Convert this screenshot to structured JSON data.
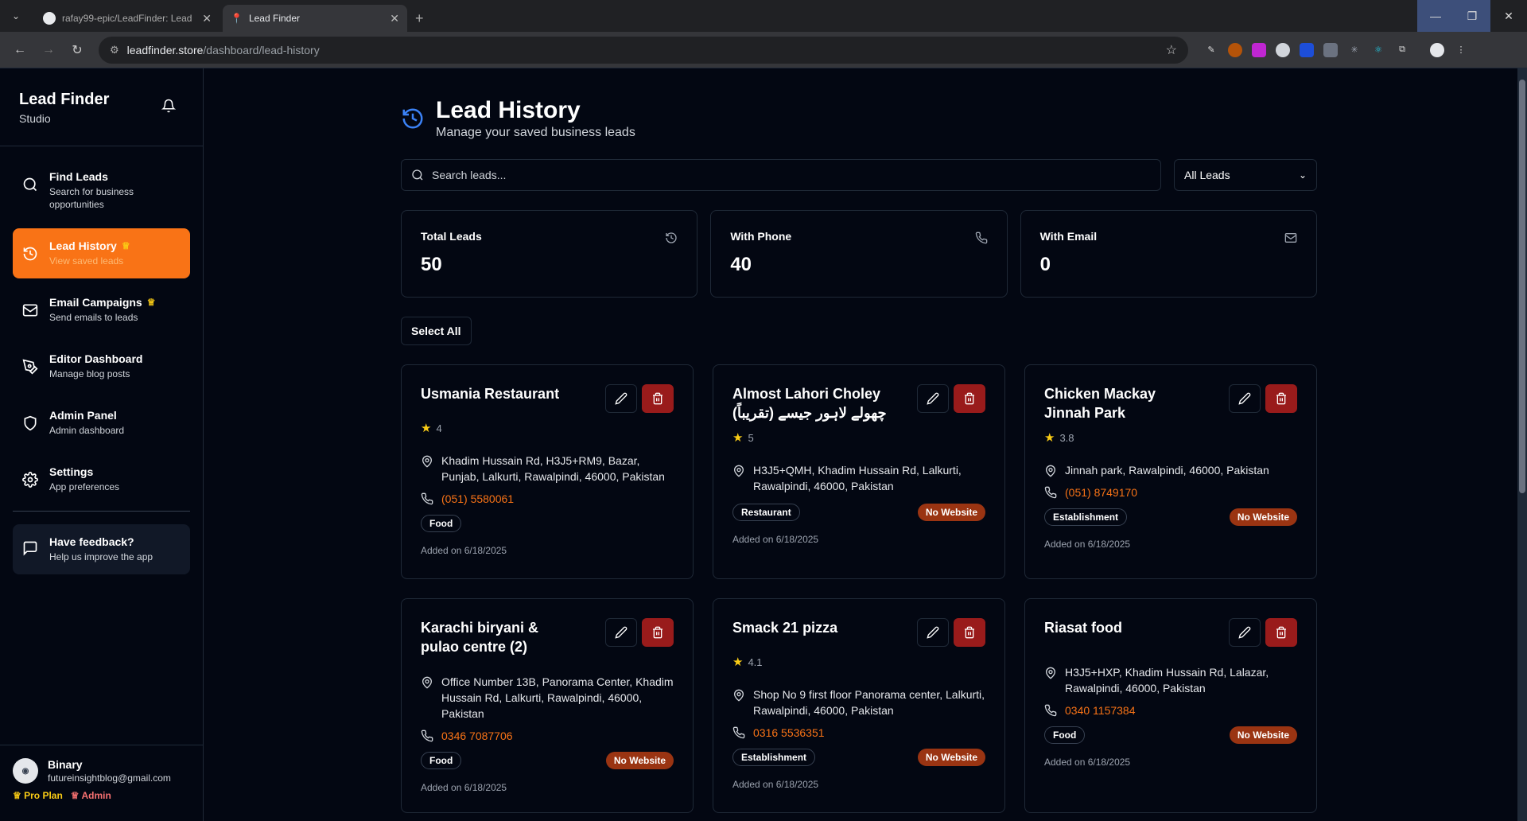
{
  "browser": {
    "tabs": [
      {
        "title": "rafay99-epic/LeadFinder: Lead",
        "active": false
      },
      {
        "title": "Lead Finder",
        "active": true
      }
    ],
    "url_host": "leadfinder.store",
    "url_path": "/dashboard/lead-history"
  },
  "sidebar": {
    "brand_title": "Lead Finder",
    "brand_sub": "Studio",
    "items": [
      {
        "label": "Find Leads",
        "desc": "Search for business opportunities",
        "icon": "search-icon",
        "active": false,
        "crown": false
      },
      {
        "label": "Lead History",
        "desc": "View saved leads",
        "icon": "history-icon",
        "active": true,
        "crown": true
      },
      {
        "label": "Email Campaigns",
        "desc": "Send emails to leads",
        "icon": "mail-icon",
        "active": false,
        "crown": true
      },
      {
        "label": "Editor Dashboard",
        "desc": "Manage blog posts",
        "icon": "pen-icon",
        "active": false,
        "crown": false
      },
      {
        "label": "Admin Panel",
        "desc": "Admin dashboard",
        "icon": "shield-icon",
        "active": false,
        "crown": false
      },
      {
        "label": "Settings",
        "desc": "App preferences",
        "icon": "gear-icon",
        "active": false,
        "crown": false
      }
    ],
    "feedback": {
      "label": "Have feedback?",
      "desc": "Help us improve the app"
    },
    "user": {
      "name": "Binary",
      "email": "futureinsightblog@gmail.com",
      "plan": "Pro Plan",
      "role": "Admin"
    }
  },
  "main": {
    "title": "Lead History",
    "subtitle": "Manage your saved business leads",
    "search_placeholder": "Search leads...",
    "filter_value": "All Leads",
    "stats": [
      {
        "label": "Total Leads",
        "value": "50",
        "icon": "history-icon"
      },
      {
        "label": "With Phone",
        "value": "40",
        "icon": "phone-icon"
      },
      {
        "label": "With Email",
        "value": "0",
        "icon": "mail-icon"
      }
    ],
    "select_all": "Select All",
    "leads": [
      {
        "name": "Usmania Restaurant",
        "rating": "4",
        "address": "Khadim Hussain Rd, H3J5+RM9, Bazar, Punjab, Lalkurti, Rawalpindi, 46000, Pakistan",
        "phone": "(051) 5580061",
        "tag": "Food",
        "no_website": "",
        "added": "Added on 6/18/2025"
      },
      {
        "name": "Almost Lahori Choley چھولے لاہور جیسے (تقریباً)",
        "rating": "5",
        "address": "H3J5+QMH, Khadim Hussain Rd, Lalkurti, Rawalpindi, 46000, Pakistan",
        "phone": "",
        "tag": "Restaurant",
        "no_website": "No Website",
        "added": "Added on 6/18/2025"
      },
      {
        "name": "Chicken Mackay Jinnah Park",
        "rating": "3.8",
        "address": "Jinnah park, Rawalpindi, 46000, Pakistan",
        "phone": "(051) 8749170",
        "tag": "Establishment",
        "no_website": "No Website",
        "added": "Added on 6/18/2025"
      },
      {
        "name": "Karachi biryani & pulao centre (2)",
        "rating": "",
        "address": "Office Number 13B, Panorama Center, Khadim Hussain Rd, Lalkurti, Rawalpindi, 46000, Pakistan",
        "phone": "0346 7087706",
        "tag": "Food",
        "no_website": "No Website",
        "added": "Added on 6/18/2025"
      },
      {
        "name": "Smack 21 pizza",
        "rating": "4.1",
        "address": "Shop No 9 first floor Panorama center, Lalkurti, Rawalpindi, 46000, Pakistan",
        "phone": "0316 5536351",
        "tag": "Establishment",
        "no_website": "No Website",
        "added": "Added on 6/18/2025"
      },
      {
        "name": "Riasat food",
        "rating": "",
        "address": "H3J5+HXP, Khadim Hussain Rd, Lalazar, Rawalpindi, 46000, Pakistan",
        "phone": "0340 1157384",
        "tag": "Food",
        "no_website": "No Website",
        "added": "Added on 6/18/2025"
      }
    ]
  },
  "colors": {
    "accent": "#f97316",
    "danger": "#991b1b",
    "star": "#facc15",
    "bg": "#030712"
  }
}
